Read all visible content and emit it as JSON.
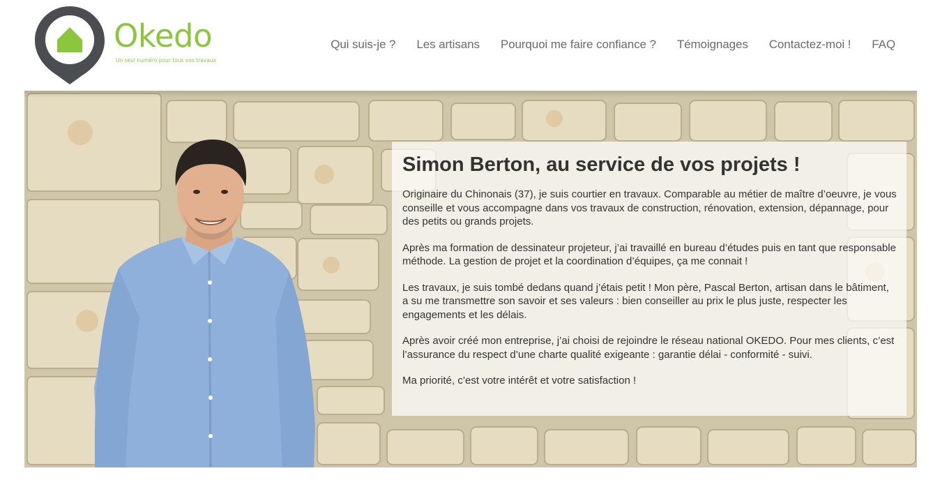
{
  "header": {
    "logo": {
      "name": "Okedo",
      "tagline": "Un seul numéro pour tous vos travaux"
    },
    "nav": [
      {
        "label": "Qui suis-je ?"
      },
      {
        "label": "Les artisans"
      },
      {
        "label": "Pourquoi me faire confiance ?"
      },
      {
        "label": "Témoignages"
      },
      {
        "label": "Contactez-moi !"
      },
      {
        "label": "FAQ"
      }
    ]
  },
  "hero": {
    "title": "Simon Berton, au service de vos projets !",
    "paragraphs": [
      "Originaire du Chinonais (37), je suis courtier en travaux. Comparable au métier de maître d’oeuvre, je vous conseille et vous accompagne dans vos travaux de construction, rénovation, extension, dépannage, pour des petits ou grands projets.",
      "Après ma formation de dessinateur projeteur, j’ai travaillé en bureau d’études puis en tant que responsable méthode. La gestion de projet et la coordination d’équipes, ça me connait !",
      "Les travaux, je suis tombé dedans quand j’étais petit ! Mon père, Pascal Berton, artisan dans le bâtiment, a su me transmettre son savoir et ses valeurs : bien conseiller au prix le plus juste, respecter les engagements et les délais.",
      "Après avoir créé mon entreprise, j’ai choisi de rejoindre le réseau national OKEDO. Pour mes clients, c’est l’assurance du respect d’une charte qualité exigeante : garantie délai - conformité - suivi.",
      "Ma priorité, c’est votre intérêt et votre satisfaction !"
    ]
  },
  "colors": {
    "brand_green": "#8cc63f",
    "pin_dark": "#4a4d52",
    "nav_text": "#6b6b6b",
    "body_text": "#333333",
    "stone": "#d8cfb6",
    "shirt": "#8fb0da"
  }
}
